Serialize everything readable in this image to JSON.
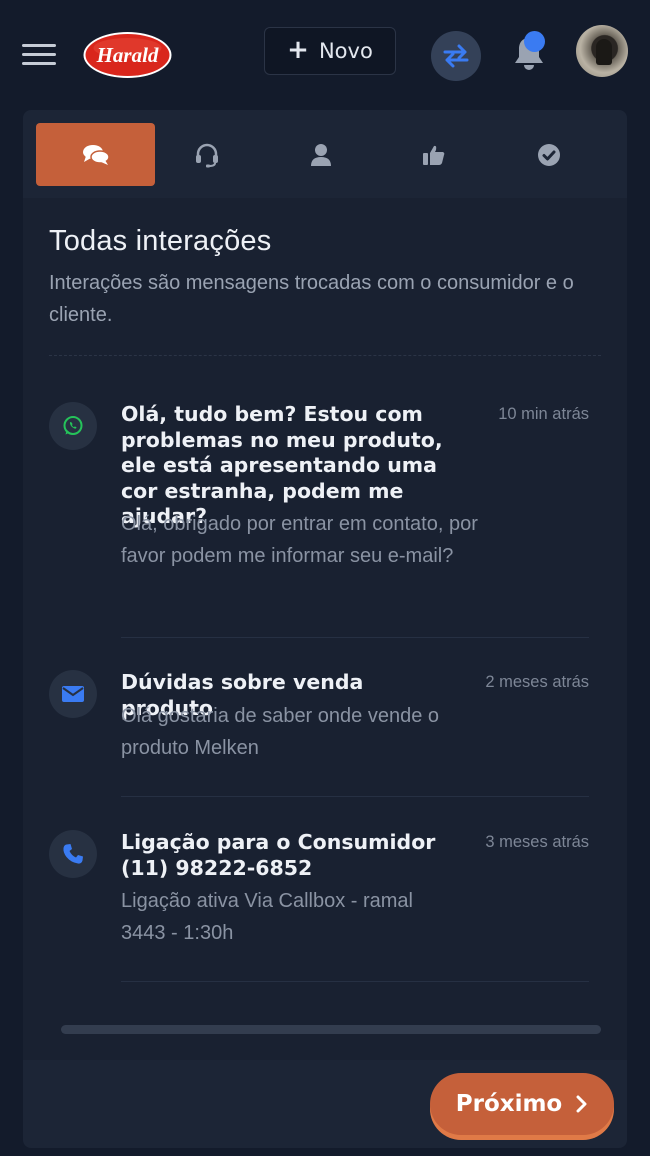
{
  "header": {
    "logo_text": "Harald",
    "new_button_label": "Novo",
    "has_notification": true
  },
  "tabs": [
    {
      "icon": "chat-bubbles-icon",
      "active": true
    },
    {
      "icon": "headset-icon",
      "active": false
    },
    {
      "icon": "user-icon",
      "active": false
    },
    {
      "icon": "thumbs-up-icon",
      "active": false
    },
    {
      "icon": "check-circle-icon",
      "active": false
    }
  ],
  "section": {
    "title": "Todas interações",
    "subtitle": "Interações são mensagens trocadas com o consumidor e o cliente."
  },
  "interactions": [
    {
      "channel_icon": "whatsapp-icon",
      "title": "Olá, tudo bem? Estou com problemas no meu produto, ele está apresentando uma cor estranha, podem me ajudar?",
      "time": "10 min atrás",
      "body": "Olá, obrigado por entrar em contato, por favor podem me informar seu e-mail?"
    },
    {
      "channel_icon": "envelope-icon",
      "title": "Dúvidas sobre venda produto",
      "time": "2 meses atrás",
      "body": "Olá gostaria de saber onde vende o produto Melken"
    },
    {
      "channel_icon": "phone-icon",
      "title": "Ligação para o Consumidor (11) 98222-6852",
      "time": "3 meses atrás",
      "body": "Ligação ativa Via Callbox - ramal 3443 - 1:30h"
    }
  ],
  "footer": {
    "next_button_label": "Próximo"
  },
  "colors": {
    "background": "#131b2b",
    "card": "#192131",
    "accent": "#c5603a",
    "whatsapp": "#25c35a",
    "blue": "#3a7bf2"
  }
}
